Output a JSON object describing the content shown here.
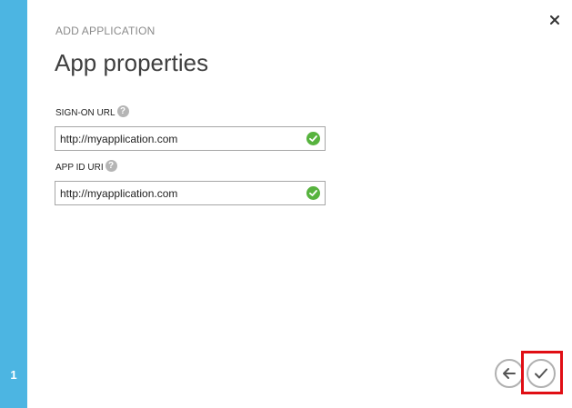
{
  "wizard": {
    "eyebrow": "ADD APPLICATION",
    "title": "App properties",
    "step_number": "1",
    "accent_color": "#4cb5e2",
    "highlight_color": "#e00e14"
  },
  "icons": {
    "close": "close-icon",
    "help": "help-icon",
    "valid": "checkmark-circle-icon",
    "back": "arrow-left-icon",
    "finish": "checkmark-icon"
  },
  "fields": {
    "sign_on_url": {
      "label": "SIGN-ON URL",
      "value": "http://myapplication.com",
      "valid_color": "#57b33e"
    },
    "app_id_uri": {
      "label": "APP ID URI",
      "value": "http://myapplication.com",
      "valid_color": "#57b33e"
    }
  }
}
